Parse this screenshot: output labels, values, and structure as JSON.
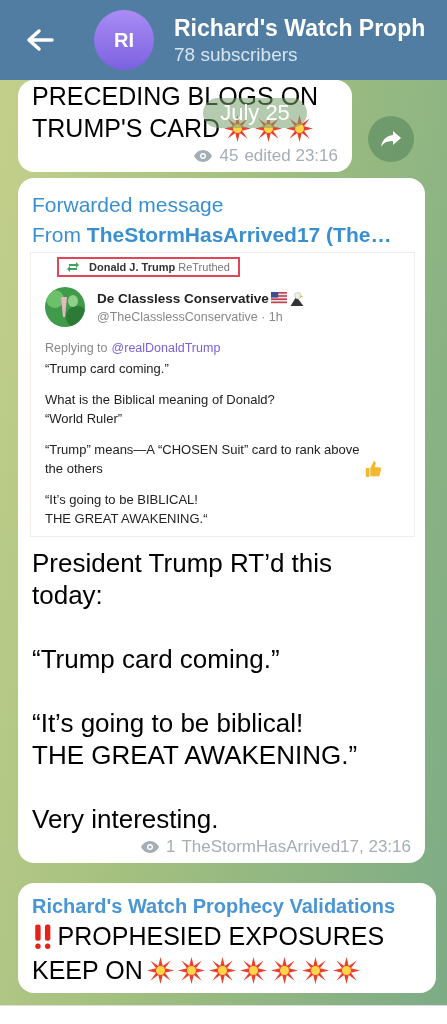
{
  "header": {
    "title": "Richard's Watch Proph",
    "avatar_initials": "RI",
    "subtitle": "78 subscribers"
  },
  "date_pill": "July 25",
  "messages": [
    {
      "kind": "post",
      "lines": [
        [
          {
            "kind": "text",
            "text": "PRECEDING BLOGS ON"
          }
        ],
        [
          {
            "kind": "text",
            "text": "TRUMP'S CARD"
          },
          {
            "kind": "burst"
          },
          {
            "kind": "burst"
          },
          {
            "kind": "burst"
          }
        ]
      ],
      "views": "45",
      "meta": "edited 23:16",
      "share_button": true
    },
    {
      "kind": "forward",
      "forward_label": "Forwarded message",
      "from": "From **TheStormHasArrived17 (The…**",
      "embedded": {
        "retruth": "**Donald J. Trump** ReTruthed",
        "author": "De Classless Conservative",
        "author_badges": [
          {
            "kind": "flag"
          },
          {
            "kind": "eagle"
          }
        ],
        "handle": "@TheClasslessConservative · 1h",
        "reply_prefix": "Replying to",
        "reply_handle": "@realDonaldTrump",
        "paragraphs": [
          {
            "lines": [
              "“Trump card coming.”"
            ]
          },
          {
            "lines": [
              "What is the Biblical meaning of Donald?",
              "“World Ruler”"
            ]
          },
          {
            "lines": [
              "“Trump” means—A “CHOSEN Suit” card to rank above",
              "the others"
            ],
            "trailing": [
              {
                "kind": "thumbs-up"
              }
            ]
          },
          {
            "lines": [
              "“It’s going to be BIBLICAL!",
              "THE GREAT AWAKENING.“"
            ]
          }
        ]
      },
      "paragraphs": [
        [
          "President Trump RT’d this",
          "today:"
        ],
        [
          "“Trump card coming.”"
        ],
        [
          "“It’s going to be biblical!",
          "THE GREAT AWAKENING.”"
        ],
        [
          "Very interesting."
        ]
      ],
      "views": "1",
      "meta": "TheStormHasArrived17, 23:16",
      "share_button": false
    },
    {
      "kind": "channel",
      "author": "Richard's Watch Prophecy Validations",
      "lines": [
        [
          {
            "kind": "double-exclamation"
          },
          {
            "kind": "text",
            "text": "PROPHESIED EXPOSURES"
          }
        ],
        [
          {
            "kind": "text",
            "text": "KEEP ON"
          },
          {
            "kind": "burst"
          },
          {
            "kind": "burst"
          },
          {
            "kind": "burst"
          },
          {
            "kind": "burst"
          },
          {
            "kind": "burst"
          },
          {
            "kind": "burst"
          },
          {
            "kind": "burst"
          }
        ]
      ],
      "share_button": false
    }
  ]
}
